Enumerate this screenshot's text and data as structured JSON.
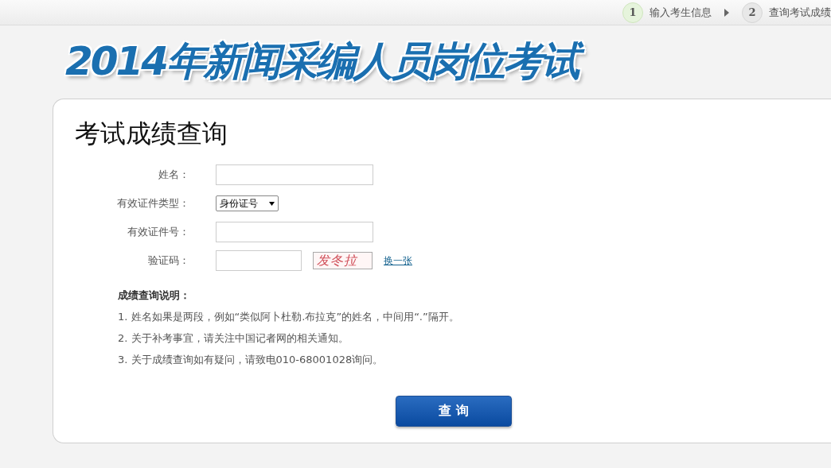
{
  "steps": [
    {
      "number": "1",
      "label": "输入考生信息",
      "selected": true
    },
    {
      "number": "2",
      "label": "查询考试成绩",
      "selected": false
    }
  ],
  "banner": {
    "title": "2014年新闻采编人员岗位考试"
  },
  "card": {
    "heading": "考试成绩查询",
    "fields": [
      {
        "kind": "text",
        "label": "姓名："
      },
      {
        "kind": "select",
        "label": "有效证件类型：",
        "value": "身份证号"
      },
      {
        "kind": "text",
        "label": "有效证件号："
      },
      {
        "kind": "captcha",
        "label": "验证码：",
        "captcha": "发冬拉",
        "refresh": "换一张"
      }
    ],
    "notes": {
      "title": "成绩查询说明：",
      "items": [
        "1. 姓名如果是两段，例如“类似阿卜杜勒.布拉克”的姓名，中间用“.”隔开。",
        "2. 关于补考事宜，请关注中国记者网的相关通知。",
        "3. 关于成绩查询如有疑问，请致电010-68001028询问。"
      ]
    },
    "submit": "查 询"
  }
}
